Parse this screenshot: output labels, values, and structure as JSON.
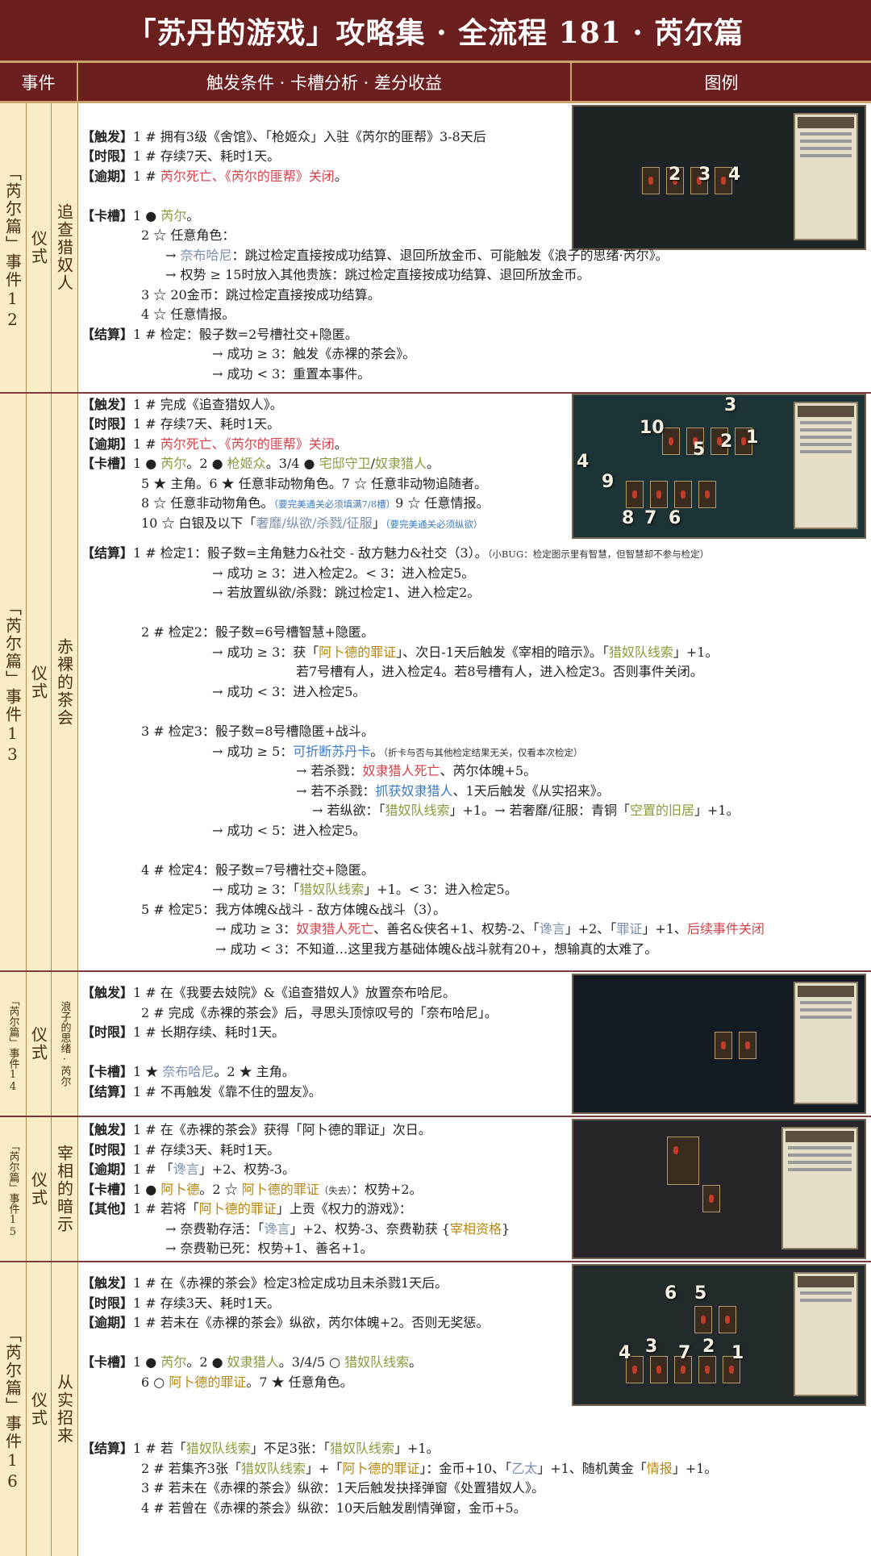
{
  "title": "「苏丹的游戏」攻略集 · 全流程 181 · 芮尔篇",
  "headers": {
    "event": "事件",
    "conditions": "触发条件 · 卡槽分析 · 差分收益",
    "legend": "图例"
  },
  "events": [
    {
      "chapter": "「芮尔篇」事件12",
      "type": "仪式",
      "name": "追查猎奴人",
      "image_numbers": [
        "2",
        "3",
        "4"
      ]
    },
    {
      "chapter": "「芮尔篇」事件13",
      "type": "仪式",
      "name": "赤裸的茶会",
      "image_numbers": [
        "3",
        "10",
        "5",
        "2",
        "1",
        "4",
        "9",
        "8",
        "7",
        "6"
      ]
    },
    {
      "chapter": "「芮尔篇」事件14",
      "type": "仪式",
      "name": "浪子的思绪·芮尔"
    },
    {
      "chapter": "「芮尔篇」事件15",
      "type": "仪式",
      "name": "宰相的暗示"
    },
    {
      "chapter": "「芮尔篇」事件16",
      "type": "仪式",
      "name": "从实招来",
      "image_numbers": [
        "6",
        "5",
        "4",
        "3",
        "7",
        "2",
        "1"
      ]
    }
  ],
  "text": {
    "e12": {
      "trigger_tag": "【触发】",
      "trigger": "1 # 拥有3级《舍馆》、「枪姬众」入驻《芮尔的匪帮》3-8天后",
      "limit_tag": "【时限】",
      "limit": "1 # 存续7天、耗时1天。",
      "expire_tag": "【逾期】",
      "expire_a": "1 # ",
      "expire_b": "芮尔死亡、《芮尔的匪帮》关闭",
      "expire_c": "。",
      "slot_tag": "【卡槽】",
      "slot1_a": "1 ● ",
      "slot1_b": "芮尔",
      "slot1_c": "。",
      "slot2": "2 ☆ 任意角色：",
      "slot2_1a": "→ ",
      "slot2_1b": "奈布哈尼",
      "slot2_1c": "：跳过检定直接按成功结算、退回所放金币、可能触发《浪子的思绪·芮尔》。",
      "slot2_2": "→ 权势 ≥ 15时放入其他贵族：跳过检定直接按成功结算、退回所放金币。",
      "slot3": "3 ☆ 20金币：跳过检定直接按成功结算。",
      "slot4": "4 ☆ 任意情报。",
      "result_tag": "【结算】",
      "result1": "1 # 检定：骰子数=2号槽社交+隐匿。",
      "result2": "→ 成功 ≥ 3：触发《赤裸的茶会》。",
      "result3": "→ 成功 < 3：重置本事件。"
    },
    "e13": {
      "trigger_tag": "【触发】",
      "trigger": "1 # 完成《追查猎奴人》。",
      "limit_tag": "【时限】",
      "limit": "1 # 存续7天、耗时1天。",
      "expire_tag": "【逾期】",
      "expire_a": "1 # ",
      "expire_b": "芮尔死亡、《芮尔的匪帮》关闭",
      "expire_c": "。",
      "slot_tag": "【卡槽】",
      "slot_a": "1 ● ",
      "slot_b": "芮尔",
      "slot_c": "。2 ● ",
      "slot_d": "枪姬众",
      "slot_e": "。3/4 ● ",
      "slot_f": "宅邸守卫",
      "slot_g": "/",
      "slot_h": "奴隶猎人",
      "slot_i": "。",
      "slot5": "5 ★ 主角。6 ★ 任意非动物角色。7 ☆ 任意非动物追随者。",
      "slot8_a": "8 ☆ 任意非动物角色。",
      "slot8_note": "（要完美通关必须填满7/8槽）",
      "slot8_b": "9 ☆ 任意情报。",
      "slot10_a": "10 ☆ 白银及以下「",
      "slot10_b": "奢靡/纵欲/杀戮/征服",
      "slot10_c": "」",
      "slot10_note": "（要完美通关必须纵欲）",
      "result_tag": "【结算】",
      "c1": "1 # 检定1：骰子数=主角魅力&社交 - 敌方魅力&社交（3）。",
      "c1_note": "（小BUG：检定图示里有智慧，但智慧却不参与检定）",
      "c1_1": "→ 成功 ≥ 3：进入检定2。< 3：进入检定5。",
      "c1_2": "→ 若放置纵欲/杀戮：跳过检定1、进入检定2。",
      "c2": "2 # 检定2：骰子数=6号槽智慧+隐匿。",
      "c2_1a": "→ 成功 ≥ 3：获「",
      "c2_1b": "阿卜德的罪证",
      "c2_1c": "」、次日-1天后触发《宰相的暗示》。「",
      "c2_1d": "猎奴队线索",
      "c2_1e": "」+1。",
      "c2_2": "若7号槽有人，进入检定4。若8号槽有人，进入检定3。否则事件关闭。",
      "c2_3": "→ 成功 < 3：进入检定5。",
      "c3": "3 # 检定3：骰子数=8号槽隐匿+战斗。",
      "c3_1a": "→ 成功 ≥ 5：",
      "c3_1b": "可折断苏丹卡",
      "c3_1c": "。",
      "c3_1note": "（折卡与否与其他检定结果无关，仅看本次检定）",
      "c3_2a": "→ 若杀戮：",
      "c3_2b": "奴隶猎人死亡",
      "c3_2c": "、芮尔体魄+5。",
      "c3_3a": "→ 若不杀戮：",
      "c3_3b": "抓获奴隶猎人",
      "c3_3c": "、1天后触发《从实招来》。",
      "c3_4a": "→ 若纵欲：「",
      "c3_4b": "猎奴队线索",
      "c3_4c": "」+1。→ 若奢靡/征服：青铜「",
      "c3_4d": "空置的旧居",
      "c3_4e": "」+1。",
      "c3_5": "→ 成功 < 5：进入检定5。",
      "c4": "4 # 检定4：骰子数=7号槽社交+隐匿。",
      "c4_1a": "→ 成功 ≥ 3：「",
      "c4_1b": "猎奴队线索",
      "c4_1c": "」+1。< 3：进入检定5。",
      "c5": "5 # 检定5：我方体魄&战斗 - 敌方体魄&战斗（3）。",
      "c5_1a": "→ 成功 ≥ 3：",
      "c5_1b": "奴隶猎人死亡",
      "c5_1c": "、善名&侠名+1、权势-2、「",
      "c5_1d": "谗言",
      "c5_1e": "」+2、「",
      "c5_1f": "罪证",
      "c5_1g": "」+1、",
      "c5_1h": "后续事件关闭",
      "c5_2": "→ 成功 < 3：不知道…这里我方基础体魄&战斗就有20+，想输真的太难了。"
    },
    "e14": {
      "trigger_tag": "【触发】",
      "trigger1": "1 # 在《我要去妓院》&《追查猎奴人》放置奈布哈尼。",
      "trigger2": "2 # 完成《赤裸的茶会》后，寻思头顶惊叹号的「奈布哈尼」。",
      "limit_tag": "【时限】",
      "limit": "1 # 长期存续、耗时1天。",
      "slot_tag": "【卡槽】",
      "slot_a": "1 ★ ",
      "slot_b": "奈布哈尼",
      "slot_c": "。2 ★ 主角。",
      "result_tag": "【结算】",
      "result": "1 # 不再触发《靠不住的盟友》。"
    },
    "e15": {
      "trigger_tag": "【触发】",
      "trigger": "1 # 在《赤裸的茶会》获得「阿卜德的罪证」次日。",
      "limit_tag": "【时限】",
      "limit": "1 # 存续3天、耗时1天。",
      "expire_tag": "【逾期】",
      "expire_a": "1 # 「",
      "expire_b": "谗言",
      "expire_c": "」+2、权势-3。",
      "slot_tag": "【卡槽】",
      "slot_a": "1 ● ",
      "slot_b": "阿卜德",
      "slot_c": "。2 ☆ ",
      "slot_d": "阿卜德的罪证",
      "slot_note": "（失去）",
      "slot_e": "：权势+2。",
      "other_tag": "【其他】",
      "other_a": "1 # 若将「",
      "other_b": "阿卜德的罪证",
      "other_c": "」上贡《权力的游戏》：",
      "other1_a": "→ 奈费勒存活：「",
      "other1_b": "谗言",
      "other1_c": "」+2、权势-3、奈费勒获 {",
      "other1_d": "宰相资格",
      "other1_e": "}",
      "other2": "→ 奈费勒已死：权势+1、善名+1。"
    },
    "e16": {
      "trigger_tag": "【触发】",
      "trigger": "1 # 在《赤裸的茶会》检定3检定成功且未杀戮1天后。",
      "limit_tag": "【时限】",
      "limit": "1 # 存续3天、耗时1天。",
      "expire_tag": "【逾期】",
      "expire": "1 # 若未在《赤裸的茶会》纵欲，芮尔体魄+2。否则无奖惩。",
      "slot_tag": "【卡槽】",
      "slot_a": "1 ● ",
      "slot_b": "芮尔",
      "slot_c": "。2 ● ",
      "slot_d": "奴隶猎人",
      "slot_e": "。3/4/5 ○ ",
      "slot_f": "猎奴队线索",
      "slot_g": "。",
      "slot6_a": "6 ○ ",
      "slot6_b": "阿卜德的罪证",
      "slot6_c": "。7 ★ 任意角色。",
      "result_tag": "【结算】",
      "r1_a": "1 # 若「",
      "r1_b": "猎奴队线索",
      "r1_c": "」不足3张：「",
      "r1_d": "猎奴队线索",
      "r1_e": "」+1。",
      "r2_a": "2 # 若集齐3张「",
      "r2_b": "猎奴队线索",
      "r2_c": "」+「",
      "r2_d": "阿卜德的罪证",
      "r2_e": "」：金币+10、「",
      "r2_f": "乙太",
      "r2_g": "」+1、随机黄金「",
      "r2_h": "情报",
      "r2_i": "」+1。",
      "r3": "3 # 若未在《赤裸的茶会》纵欲：1天后触发抉择弹窗《处置猎奴人》。",
      "r4": "4 # 若曾在《赤裸的茶会》纵欲：10天后触发剧情弹窗，金币+5。"
    }
  },
  "colors": {
    "header_bg": "#6b1f1f",
    "side_bg": "#f8edc4",
    "red": "#d8404a",
    "gold": "#b8860b",
    "olive": "#8c9a3a",
    "blue": "#3b7ac3"
  }
}
